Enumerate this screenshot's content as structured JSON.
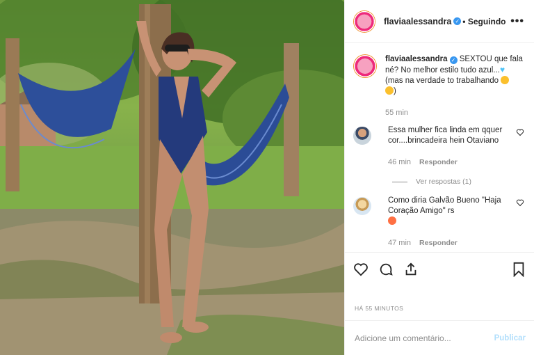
{
  "post": {
    "username": "flaviaalessandra",
    "follow_state": "• Seguindo",
    "more_label": "•••",
    "caption_text": "SEXTOU que fala né? No melhor estilo tudo azul...",
    "caption_text_2": "(mas na verdade to trabalhando",
    "caption_text_3": ")",
    "caption_time": "55 min",
    "time_ago": "HÁ 55 MINUTOS"
  },
  "comments": [
    {
      "text": "Essa mulher fica linda em qquer cor....brincadeira hein Otaviano",
      "time": "46 min",
      "reply_label": "Responder",
      "view_replies": "Ver respostas (1)"
    },
    {
      "text": "Como diria Galvão Bueno \"Haja Coração Amigo\" rs",
      "time": "47 min",
      "reply_label": "Responder"
    }
  ],
  "add_comment": {
    "placeholder": "Adicione um comentário...",
    "post_label": "Publicar"
  },
  "colors": {
    "accent_blue": "#3897f0",
    "disabled_blue": "#b2dffc",
    "muted": "#8e8e8e"
  },
  "icons": [
    "heart-icon",
    "comment-icon",
    "share-icon",
    "bookmark-icon",
    "more-icon",
    "verified-icon"
  ]
}
